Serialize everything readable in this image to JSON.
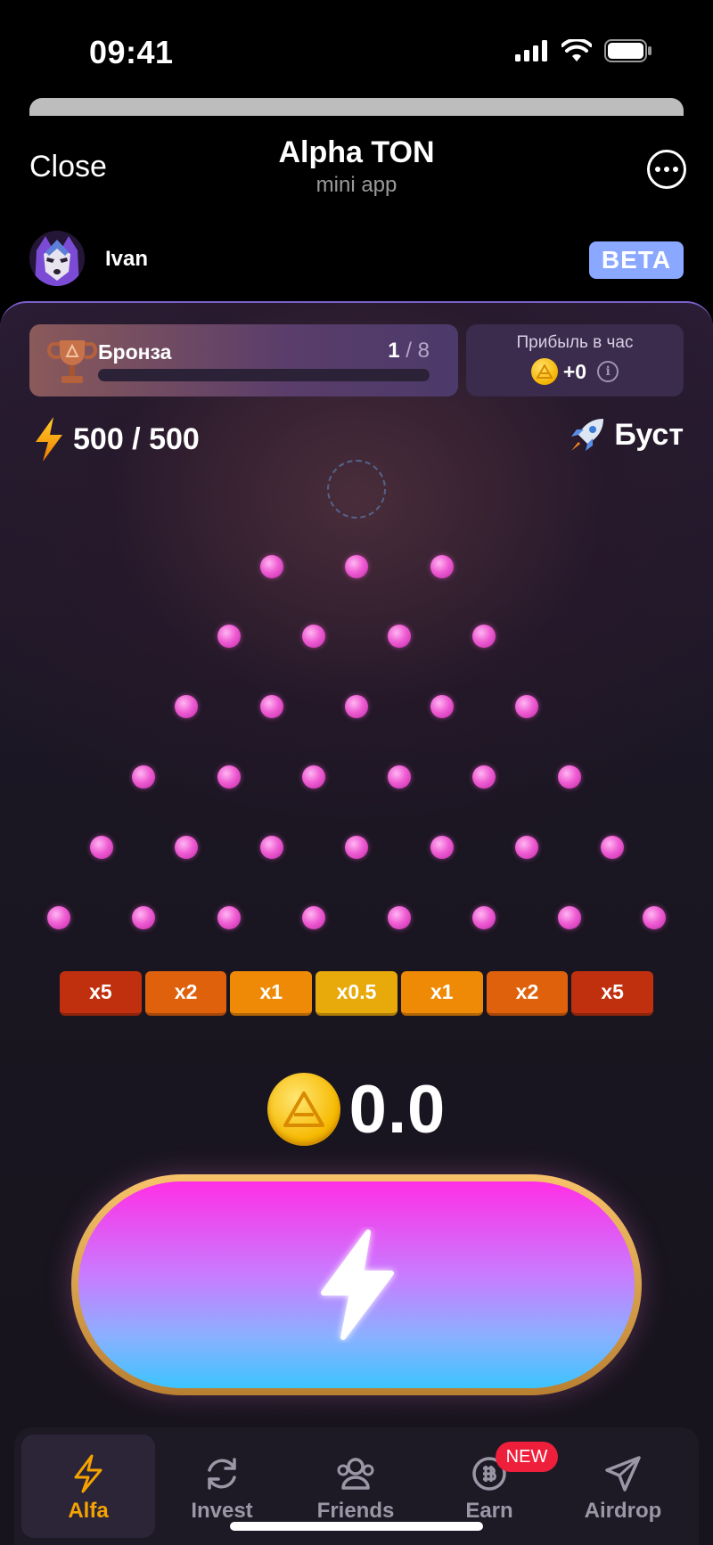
{
  "status": {
    "time": "09:41"
  },
  "header": {
    "close_label": "Close",
    "title": "Alpha TON",
    "subtitle": "mini app"
  },
  "user": {
    "name": "Ivan",
    "badge": "BETA"
  },
  "league": {
    "name": "Бронза",
    "current": "1",
    "total": " / 8",
    "progress": 0
  },
  "profit": {
    "label": "Прибыль в час",
    "value": "+0"
  },
  "energy": {
    "text": "500 / 500"
  },
  "boost": {
    "label": "Буст"
  },
  "multipliers": [
    {
      "label": "x5",
      "color": "#c0300e"
    },
    {
      "label": "x2",
      "color": "#e0610c"
    },
    {
      "label": "x1",
      "color": "#ef8a06"
    },
    {
      "label": "x0.5",
      "color": "#e8a90a"
    },
    {
      "label": "x1",
      "color": "#ef8a06"
    },
    {
      "label": "x2",
      "color": "#e0610c"
    },
    {
      "label": "x5",
      "color": "#c0300e"
    }
  ],
  "balance": {
    "value": "0.0"
  },
  "nav": [
    {
      "label": "Alfa",
      "icon": "lightning-icon",
      "active": true
    },
    {
      "label": "Invest",
      "icon": "refresh-icon",
      "active": false
    },
    {
      "label": "Friends",
      "icon": "friends-icon",
      "active": false
    },
    {
      "label": "Earn",
      "icon": "coin-icon",
      "active": false,
      "badge": "NEW"
    },
    {
      "label": "Airdrop",
      "icon": "paper-plane-icon",
      "active": false
    }
  ],
  "colors": {
    "accent": "#f5a300",
    "peg": "#ef5dd3",
    "beta": "#8aa8ff",
    "new_badge": "#ee1f3a"
  }
}
